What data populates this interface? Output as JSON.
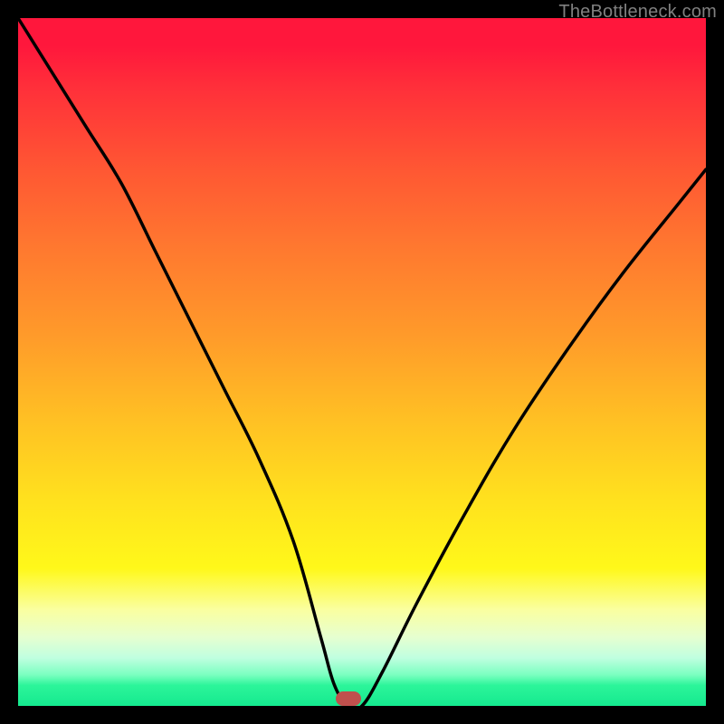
{
  "watermark": "TheBottleneck.com",
  "colors": {
    "frame": "#000000",
    "curve": "#000000",
    "marker": "#c0504d",
    "gradient_top": "#ff173c",
    "gradient_bottom": "#15e98f"
  },
  "chart_data": {
    "type": "line",
    "title": "",
    "xlabel": "",
    "ylabel": "",
    "xlim": [
      0,
      100
    ],
    "ylim": [
      0,
      100
    ],
    "grid": false,
    "legend": false,
    "annotations": [
      "TheBottleneck.com"
    ],
    "marker": {
      "x_pct": 48,
      "y_pct": 99
    },
    "series": [
      {
        "name": "bottleneck-curve",
        "x": [
          0,
          5,
          10,
          15,
          20,
          25,
          30,
          35,
          40,
          44,
          46,
          48,
          50,
          53,
          58,
          65,
          72,
          80,
          88,
          96,
          100
        ],
        "y_pct": [
          100,
          92,
          84,
          76,
          66,
          56,
          46,
          36,
          24,
          10,
          3,
          0,
          0,
          5,
          15,
          28,
          40,
          52,
          63,
          73,
          78
        ]
      }
    ],
    "notes": "y_pct is percent height above bottom axis; values estimated from pixels."
  }
}
